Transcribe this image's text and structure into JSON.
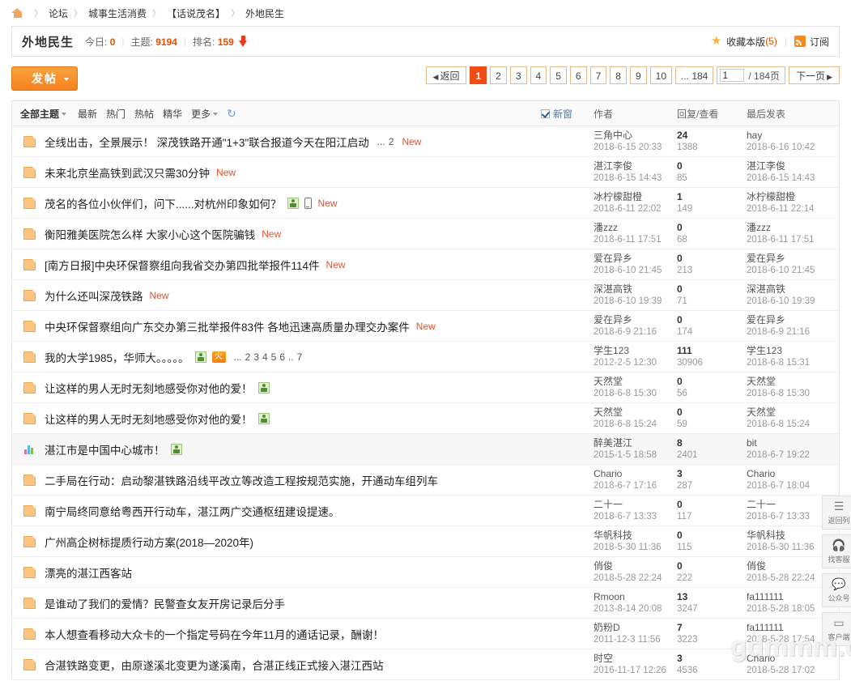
{
  "breadcrumb": {
    "home_icon": "home-icon",
    "items": [
      "论坛",
      "城事生活消费",
      "【话说茂名】",
      "外地民生"
    ],
    "separator": "〉"
  },
  "forum_header": {
    "name": "外地民生",
    "today_label": "今日:",
    "today_value": "0",
    "threads_label": "主题:",
    "threads_value": "9194",
    "rank_label": "排名:",
    "rank_value": "159",
    "favorite_label": "收藏本版",
    "favorite_count": "(5)",
    "subscribe_label": "订阅",
    "accent_color": "#e54e00"
  },
  "toolbar": {
    "post_label": "发帖"
  },
  "pager": {
    "back_label": "返回",
    "pages": [
      "1",
      "2",
      "3",
      "4",
      "5",
      "6",
      "7",
      "8",
      "9",
      "10"
    ],
    "current": "1",
    "ellipsis_last": "... 184",
    "jump_value": "1",
    "jump_suffix": "/ 184页",
    "next_label": "下一页"
  },
  "filter_bar": {
    "all_topics": "全部主题",
    "links": [
      "最新",
      "热门",
      "热帖",
      "精华",
      "更多"
    ],
    "refresh_icon": "refresh-icon",
    "newwin_label": "新窗",
    "newwin_checked": true,
    "col_author": "作者",
    "col_replies_views": "回复/查看",
    "col_last": "最后发表"
  },
  "threads": [
    {
      "icon": "folder",
      "title": "全线出击，全景展示！ 深茂铁路开通\"1+3\"联合报道今天在阳江启动",
      "badges": [],
      "pagelinks": [
        "...",
        "2"
      ],
      "new": true,
      "author": "三角中心",
      "author_time": "2018-6-15 20:33",
      "replies": "24",
      "views": "1388",
      "last_user": "hay",
      "last_time": "2018-6-16 10:42",
      "alt": false
    },
    {
      "icon": "folder",
      "title": "未来北京坐高铁到武汉只需30分钟",
      "badges": [],
      "pagelinks": [],
      "new": true,
      "author": "湛江李俊",
      "author_time": "2018-6-15 14:43",
      "replies": "0",
      "views": "85",
      "last_user": "湛江李俊",
      "last_time": "2018-6-15 14:43",
      "alt": false
    },
    {
      "icon": "folder",
      "title": "茂名的各位小伙伴们，问下......对杭州印象如何？",
      "badges": [
        "attachment",
        "mobile"
      ],
      "pagelinks": [],
      "new": true,
      "author": "冰柠檬甜橙",
      "author_time": "2018-6-11 22:02",
      "replies": "1",
      "views": "149",
      "last_user": "冰柠檬甜橙",
      "last_time": "2018-6-11 22:14",
      "alt": false
    },
    {
      "icon": "folder",
      "title": "衡阳雅美医院怎么样 大家小心这个医院骗钱",
      "badges": [],
      "pagelinks": [],
      "new": true,
      "author": "潘zzz",
      "author_time": "2018-6-11 17:51",
      "replies": "0",
      "views": "68",
      "last_user": "潘zzz",
      "last_time": "2018-6-11 17:51",
      "alt": false
    },
    {
      "icon": "folder",
      "title": "[南方日报]中央环保督察组向我省交办第四批举报件114件",
      "badges": [],
      "pagelinks": [],
      "new": true,
      "author": "爱在异乡",
      "author_time": "2018-6-10 21:45",
      "replies": "0",
      "views": "213",
      "last_user": "爱在异乡",
      "last_time": "2018-6-10 21:45",
      "alt": false
    },
    {
      "icon": "folder",
      "title": "为什么还叫深茂铁路",
      "badges": [],
      "pagelinks": [],
      "new": true,
      "author": "深湛高铁",
      "author_time": "2018-6-10 19:39",
      "replies": "0",
      "views": "71",
      "last_user": "深湛高铁",
      "last_time": "2018-6-10 19:39",
      "alt": false
    },
    {
      "icon": "folder",
      "title": "中央环保督察组向广东交办第三批举报件83件 各地迅速高质量办理交办案件",
      "badges": [],
      "pagelinks": [],
      "new": true,
      "author": "爱在异乡",
      "author_time": "2018-6-9 21:16",
      "replies": "0",
      "views": "174",
      "last_user": "爱在异乡",
      "last_time": "2018-6-9 21:16",
      "alt": false
    },
    {
      "icon": "folder",
      "title": "我的大学1985，华师大。。。。。",
      "badges": [
        "attachment",
        "hot"
      ],
      "pagelinks": [
        "...",
        "2",
        "3",
        "4",
        "5",
        "6",
        "..",
        "7"
      ],
      "new": false,
      "author": "学生123",
      "author_time": "2012-2-5 12:30",
      "replies": "111",
      "views": "30906",
      "last_user": "学生123",
      "last_time": "2018-6-8 15:31",
      "alt": false
    },
    {
      "icon": "folder",
      "title": "让这样的男人无时无刻地感受你对他的爱！",
      "badges": [
        "attachment"
      ],
      "pagelinks": [],
      "new": false,
      "author": "天然堂",
      "author_time": "2018-6-8 15:30",
      "replies": "0",
      "views": "56",
      "last_user": "天然堂",
      "last_time": "2018-6-8 15:30",
      "alt": false
    },
    {
      "icon": "folder",
      "title": "让这样的男人无时无刻地感受你对他的爱！",
      "badges": [
        "attachment"
      ],
      "pagelinks": [],
      "new": false,
      "author": "天然堂",
      "author_time": "2018-6-8 15:24",
      "replies": "0",
      "views": "59",
      "last_user": "天然堂",
      "last_time": "2018-6-8 15:24",
      "alt": false
    },
    {
      "icon": "poll",
      "title": "湛江市是中国中心城市！",
      "badges": [
        "attachment"
      ],
      "pagelinks": [],
      "new": false,
      "author": "醉美湛江",
      "author_time": "2015-1-5 18:58",
      "replies": "8",
      "views": "2401",
      "last_user": "bit",
      "last_time": "2018-6-7 19:22",
      "alt": true
    },
    {
      "icon": "folder",
      "title": "二手局在行动：启动黎湛铁路沿线平改立等改造工程按规范实施，开通动车组列车",
      "badges": [],
      "pagelinks": [],
      "new": false,
      "author": "Chario",
      "author_time": "2018-6-7 17:16",
      "replies": "3",
      "views": "287",
      "last_user": "Chario",
      "last_time": "2018-6-7 18:04",
      "alt": false
    },
    {
      "icon": "folder",
      "title": "南宁局终同意给粤西开行动车，湛江两广交通枢纽建设提速。",
      "badges": [],
      "pagelinks": [],
      "new": false,
      "author": "二十一",
      "author_time": "2018-6-7 13:33",
      "replies": "0",
      "views": "117",
      "last_user": "二十一",
      "last_time": "2018-6-7 13:33",
      "alt": false
    },
    {
      "icon": "folder",
      "title": "广州高企树标提质行动方案(2018—2020年)",
      "badges": [],
      "pagelinks": [],
      "new": false,
      "author": "华帆科技",
      "author_time": "2018-5-30 11:36",
      "replies": "0",
      "views": "115",
      "last_user": "华帆科技",
      "last_time": "2018-5-30 11:36",
      "alt": false
    },
    {
      "icon": "folder",
      "title": "漂亮的湛江西客站",
      "badges": [],
      "pagelinks": [],
      "new": false,
      "author": "俏俊",
      "author_time": "2018-5-28 22:24",
      "replies": "0",
      "views": "222",
      "last_user": "俏俊",
      "last_time": "2018-5-28 22:24",
      "alt": false
    },
    {
      "icon": "folder",
      "title": "是谁动了我们的爱情？民警查女友开房记录后分手",
      "badges": [],
      "pagelinks": [],
      "new": false,
      "author": "Rmoon",
      "author_time": "2013-8-14 20:08",
      "replies": "13",
      "views": "3247",
      "last_user": "fa111111",
      "last_time": "2018-5-28 18:05",
      "alt": false
    },
    {
      "icon": "folder",
      "title": "本人想查看移动大众卡的一个指定号码在今年11月的通话记录，酬谢！",
      "badges": [],
      "pagelinks": [],
      "new": false,
      "author": "奶粉D",
      "author_time": "2011-12-3 11:56",
      "replies": "7",
      "views": "3223",
      "last_user": "fa111111",
      "last_time": "2018-5-28 17:54",
      "alt": false
    },
    {
      "icon": "folder",
      "title": "合湛铁路变更，由原遂溪北变更为遂溪南，合湛正线正式接入湛江西站",
      "badges": [],
      "pagelinks": [],
      "new": false,
      "author": "时空",
      "author_time": "2016-11-17 12:26",
      "replies": "3",
      "views": "4536",
      "last_user": "Chario",
      "last_time": "2018-5-28 17:02",
      "alt": false
    }
  ],
  "float_toolbar": [
    {
      "icon": "list-icon",
      "label": "返回列"
    },
    {
      "icon": "headset-icon",
      "label": "找客服"
    },
    {
      "icon": "wechat-icon",
      "label": "公众号"
    },
    {
      "icon": "app-icon",
      "label": "客户端"
    }
  ],
  "watermark": "gdmmm.com"
}
